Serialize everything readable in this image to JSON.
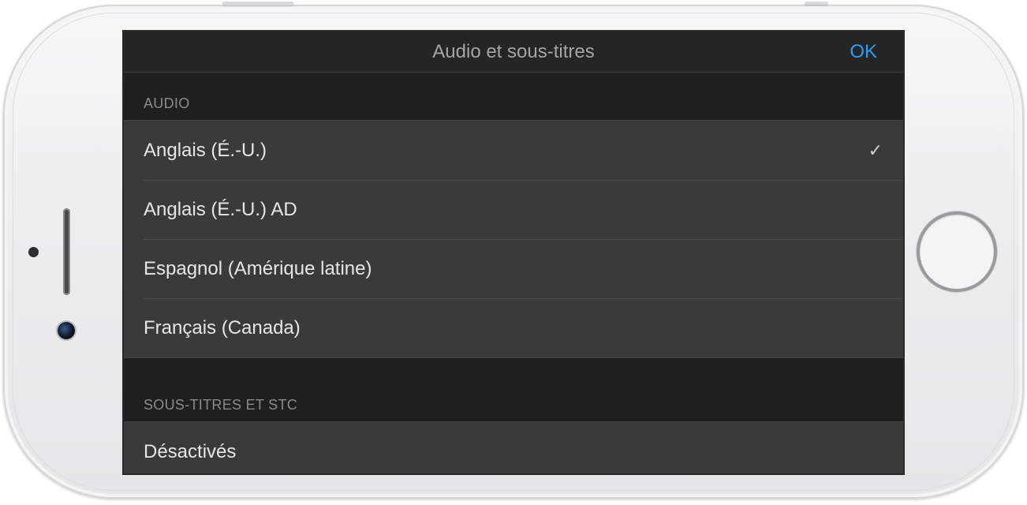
{
  "nav": {
    "title": "Audio et sous-titres",
    "done_label": "OK"
  },
  "audio": {
    "header": "AUDIO",
    "items": [
      {
        "label": "Anglais (É.-U.)",
        "check": "✓"
      },
      {
        "label": "Anglais (É.-U.) AD",
        "check": ""
      },
      {
        "label": "Espagnol (Amérique latine)",
        "check": ""
      },
      {
        "label": "Français (Canada)",
        "check": ""
      }
    ]
  },
  "subtitles": {
    "header": "SOUS-TITRES ET STC",
    "items": [
      {
        "label": "Désactivés"
      }
    ]
  },
  "colors": {
    "accent": "#2f9df4",
    "background": "#1f1f1f",
    "cell": "#3a3a3a"
  }
}
